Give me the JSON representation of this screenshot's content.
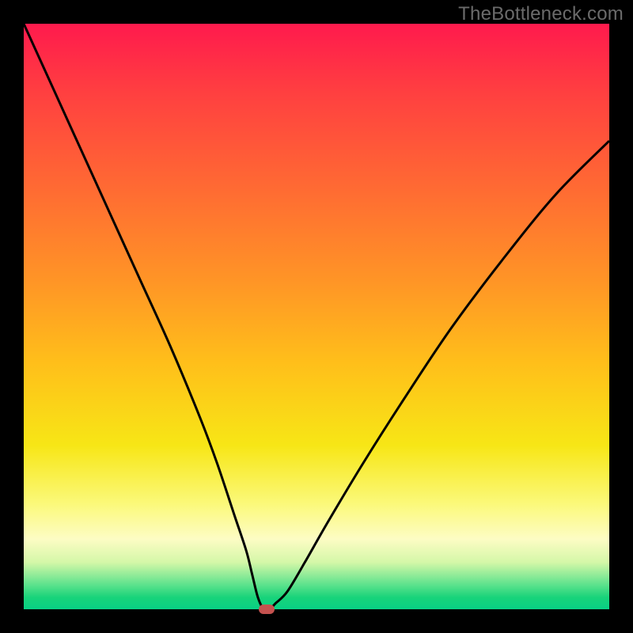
{
  "watermark": "TheBottleneck.com",
  "colors": {
    "frame": "#000000",
    "curve": "#000000",
    "marker": "#c5524f",
    "gradient_top": "#ff1a4d",
    "gradient_bottom": "#08d084"
  },
  "chart_data": {
    "type": "line",
    "title": "",
    "xlabel": "",
    "ylabel": "",
    "xlim": [
      0,
      100
    ],
    "ylim": [
      0,
      100
    ],
    "grid": false,
    "legend": false,
    "series": [
      {
        "name": "bottleneck-curve",
        "x": [
          0,
          5,
          10,
          15,
          20,
          25,
          30,
          33,
          36,
          38,
          39,
          40,
          41,
          42,
          43,
          45,
          48,
          52,
          58,
          65,
          73,
          82,
          91,
          100
        ],
        "values": [
          100,
          89,
          78,
          67,
          56,
          45,
          33,
          25,
          16,
          10,
          6,
          2,
          0,
          0,
          1,
          3,
          8,
          15,
          25,
          36,
          48,
          60,
          71,
          80
        ]
      }
    ],
    "annotations": [
      {
        "name": "min-marker",
        "x": 41.5,
        "y": 0
      }
    ]
  }
}
